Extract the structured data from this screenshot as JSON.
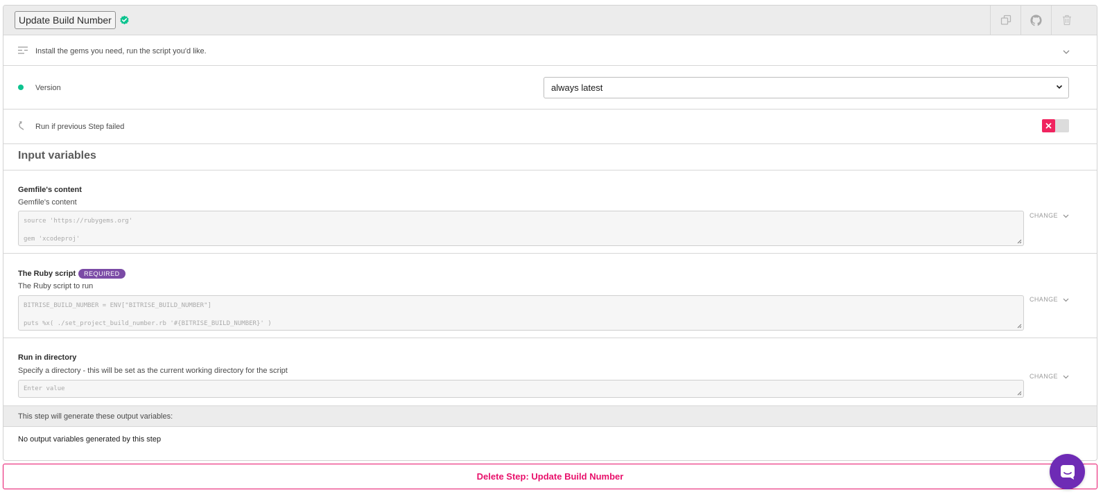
{
  "step": {
    "title": "Update Build Number",
    "description": "Install the gems you need, run the script you'd like."
  },
  "header_icons": [
    "copy-icon",
    "github-icon",
    "trash-icon"
  ],
  "version": {
    "label": "Version",
    "selected": "always latest"
  },
  "run_if": {
    "label": "Run if previous Step failed",
    "enabled": false
  },
  "inputs": {
    "heading": "Input variables",
    "gemfile": {
      "title": "Gemfile's content",
      "subtitle": "Gemfile's content",
      "line1": "source 'https://rubygems.org'",
      "line2": "gem 'xcodeproj'",
      "change_label": "CHANGE"
    },
    "ruby_script": {
      "title": "The Ruby script",
      "badge": "REQUIRED",
      "subtitle": "The Ruby script to run",
      "line1": "BITRISE_BUILD_NUMBER = ENV[\"BITRISE_BUILD_NUMBER\"]",
      "line2": "puts %x( ./set_project_build_number.rb '#{BITRISE_BUILD_NUMBER}' )",
      "change_label": "CHANGE"
    },
    "run_dir": {
      "title": "Run in directory",
      "subtitle": "Specify a directory - this will be set as the current working directory for the script",
      "placeholder": "Enter value",
      "change_label": "CHANGE"
    }
  },
  "outputs": {
    "header": "This step will generate these output variables:",
    "empty": "No output variables generated by this step"
  },
  "delete_button": "Delete Step: Update Build Number",
  "colors": {
    "accent_pink": "#e8116b",
    "success_green": "#0dc38f",
    "required_purple": "#7b4ba6",
    "chat_purple": "#6e2bb5"
  }
}
